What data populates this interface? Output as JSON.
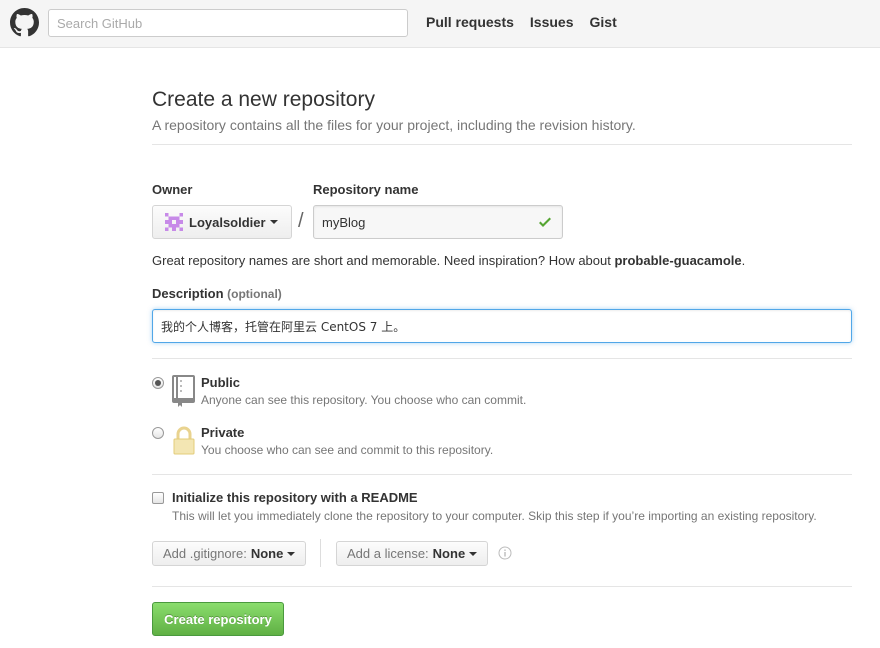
{
  "header": {
    "search_placeholder": "Search GitHub",
    "nav": [
      "Pull requests",
      "Issues",
      "Gist"
    ]
  },
  "page": {
    "title": "Create a new repository",
    "subtitle": "A repository contains all the files for your project, including the revision history."
  },
  "form": {
    "owner_label": "Owner",
    "owner_value": "Loyalsoldier",
    "slash": "/",
    "repo_label": "Repository name",
    "repo_value": "myBlog",
    "hint_prefix": "Great repository names are short and memorable. Need inspiration? How about ",
    "hint_suggestion": "probable-guacamole",
    "hint_suffix": ".",
    "description_label": "Description",
    "description_optional": "(optional)",
    "description_value": "我的个人博客，托管在阿里云 CentOS 7 上。",
    "visibility": [
      {
        "title": "Public",
        "desc": "Anyone can see this repository. You choose who can commit.",
        "checked": true
      },
      {
        "title": "Private",
        "desc": "You choose who can see and commit to this repository.",
        "checked": false
      }
    ],
    "readme_title": "Initialize this repository with a README",
    "readme_desc": "This will let you immediately clone the repository to your computer. Skip this step if you’re importing an existing repository.",
    "gitignore_label": "Add .gitignore:",
    "gitignore_value": "None",
    "license_label": "Add a license:",
    "license_value": "None",
    "submit_label": "Create repository"
  },
  "colors": {
    "accent_green": "#60b044",
    "focus_blue": "#51a7e8",
    "check_green": "#55a532",
    "identicon_purple": "#c78ae8"
  },
  "icons": [
    "github-logo-icon",
    "identicon-avatar",
    "check-icon",
    "repo-icon",
    "lock-icon",
    "info-icon"
  ]
}
